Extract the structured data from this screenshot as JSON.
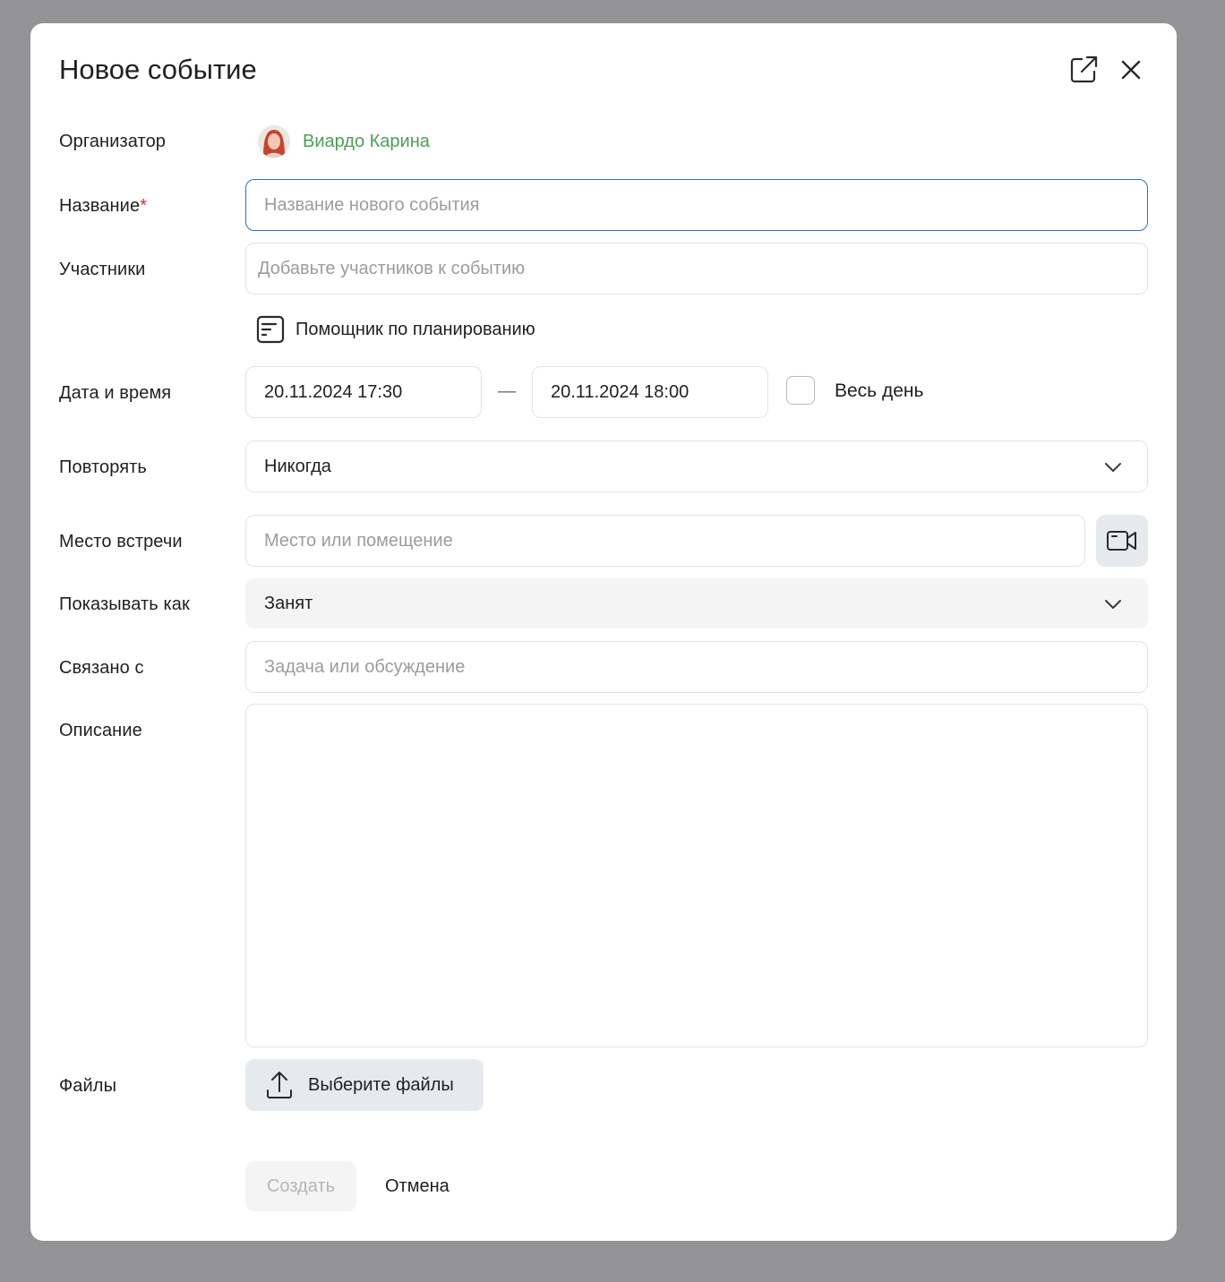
{
  "dialog": {
    "title": "Новое событие"
  },
  "organizer": {
    "label": "Организатор",
    "name": "Виардо Карина"
  },
  "name_field": {
    "label": "Название",
    "required_mark": "*",
    "value": "",
    "placeholder": "Название нового события"
  },
  "participants": {
    "label": "Участники",
    "value": "",
    "placeholder": "Добавьте участников к событию"
  },
  "planner": {
    "label": "Помощник по планированию"
  },
  "datetime": {
    "label": "Дата и время",
    "start": "20.11.2024 17:30",
    "separator": "—",
    "end": "20.11.2024 18:00",
    "all_day_label": "Весь день",
    "all_day_checked": false
  },
  "repeat": {
    "label": "Повторять",
    "selected": "Никогда"
  },
  "location": {
    "label": "Место встречи",
    "value": "",
    "placeholder": "Место или помещение"
  },
  "show_as": {
    "label": "Показывать как",
    "selected": "Занят"
  },
  "related": {
    "label": "Связано с",
    "value": "",
    "placeholder": "Задача или обсуждение"
  },
  "description": {
    "label": "Описание",
    "value": ""
  },
  "files": {
    "label": "Файлы",
    "button_label": "Выберите файлы"
  },
  "footer": {
    "create_label": "Создать",
    "cancel_label": "Отмена"
  },
  "colors": {
    "overlay": "#939395",
    "accent_focus": "#2b6fcf",
    "organizer_name": "#4a9f55",
    "required": "#d32f2f"
  },
  "icons": {
    "popout": "external-link-icon",
    "close": "close-icon",
    "planner": "planner-icon",
    "video": "video-camera-icon",
    "chevron": "chevron-down-icon",
    "upload": "upload-icon"
  }
}
